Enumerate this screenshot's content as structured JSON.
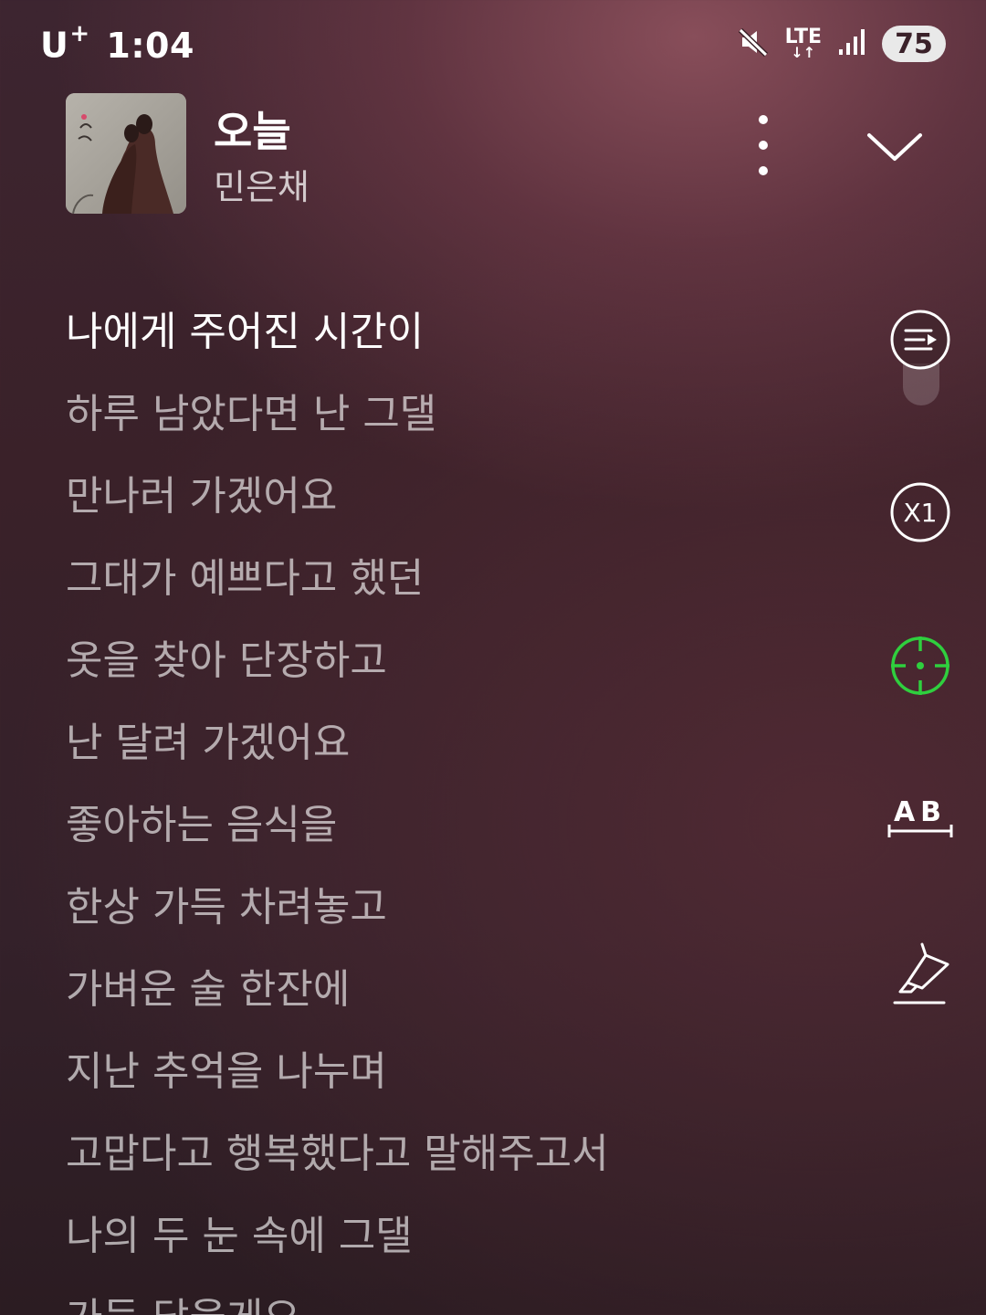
{
  "status_bar": {
    "carrier": "U",
    "carrier_plus": "+",
    "time": "1:04",
    "network": "LTE",
    "network_arrows": "↓↑",
    "battery": "75"
  },
  "song": {
    "title": "오늘",
    "artist": "민은채"
  },
  "lyrics": [
    "나에게 주어진 시간이",
    "하루 남았다면 난 그댈",
    "만나러 가겠어요",
    "그대가 예쁘다고 했던",
    "옷을 찾아 단장하고",
    "난 달려 가겠어요",
    "좋아하는 음식을",
    "한상 가득 차려놓고",
    "가벼운 술 한잔에",
    "지난 추억을 나누며",
    "고맙다고 행복했다고 말해주고서",
    "나의 두 눈 속에 그댈",
    "가득 담을게요"
  ],
  "active_lyric_index": 0,
  "controls": {
    "speed_label": "X1",
    "ab_label": "AB"
  },
  "colors": {
    "sync_icon": "#2fcf3e",
    "background_top": "#7a3f4d",
    "background_bottom": "#2b1c22"
  },
  "icons": [
    "mute-icon",
    "signal-icon",
    "more-vert-icon",
    "chevron-down-icon",
    "playlist-icon",
    "speed-icon",
    "crosshair-sync-icon",
    "ab-repeat-icon",
    "highlight-pen-icon"
  ]
}
